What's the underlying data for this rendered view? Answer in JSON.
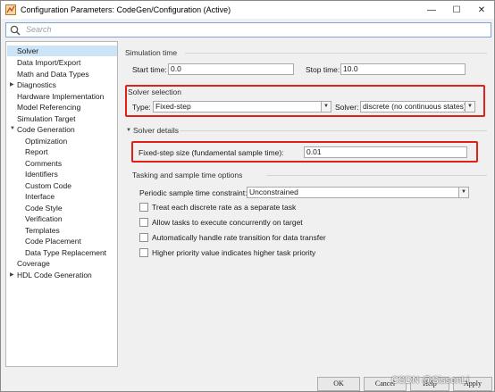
{
  "window": {
    "title": "Configuration Parameters: CodeGen/Configuration (Active)",
    "minimize": "—",
    "maximize": "☐",
    "close": "✕"
  },
  "search": {
    "placeholder": "Search"
  },
  "tree": {
    "items": [
      {
        "label": "Solver",
        "selected": true
      },
      {
        "label": "Data Import/Export"
      },
      {
        "label": "Math and Data Types"
      },
      {
        "label": "Diagnostics",
        "expandable": true
      },
      {
        "label": "Hardware Implementation"
      },
      {
        "label": "Model Referencing"
      },
      {
        "label": "Simulation Target"
      },
      {
        "label": "Code Generation",
        "expanded": true
      },
      {
        "label": "Optimization"
      },
      {
        "label": "Report"
      },
      {
        "label": "Comments"
      },
      {
        "label": "Identifiers"
      },
      {
        "label": "Custom Code"
      },
      {
        "label": "Interface"
      },
      {
        "label": "Code Style"
      },
      {
        "label": "Verification"
      },
      {
        "label": "Templates"
      },
      {
        "label": "Code Placement"
      },
      {
        "label": "Data Type Replacement"
      },
      {
        "label": "Coverage"
      },
      {
        "label": "HDL Code Generation",
        "expandable": true
      }
    ]
  },
  "simulation_time": {
    "title": "Simulation time",
    "start_label": "Start time:",
    "start_value": "0.0",
    "stop_label": "Stop time:",
    "stop_value": "10.0"
  },
  "solver_selection": {
    "title": "Solver selection",
    "type_label": "Type:",
    "type_value": "Fixed-step",
    "solver_label": "Solver:",
    "solver_value": "discrete (no continuous states)"
  },
  "solver_details": {
    "title": "Solver details",
    "step_label": "Fixed-step size (fundamental sample time):",
    "step_value": "0.01"
  },
  "tasking": {
    "title": "Tasking and sample time options",
    "constraint_label": "Periodic sample time constraint:",
    "constraint_value": "Unconstrained",
    "checks": [
      {
        "label": "Treat each discrete rate as a separate task",
        "checked": false
      },
      {
        "label": "Allow tasks to execute concurrently on target",
        "checked": false
      },
      {
        "label": "Automatically handle rate transition for data transfer",
        "checked": false
      },
      {
        "label": "Higher priority value indicates higher task priority",
        "checked": false
      }
    ]
  },
  "buttons": {
    "ok": "OK",
    "cancel": "Cancel",
    "help": "Help",
    "apply": "Apply"
  },
  "watermark": "CSDN @SissonLi",
  "colors": {
    "highlight": "#e0201a",
    "selection": "#cce4f7"
  }
}
